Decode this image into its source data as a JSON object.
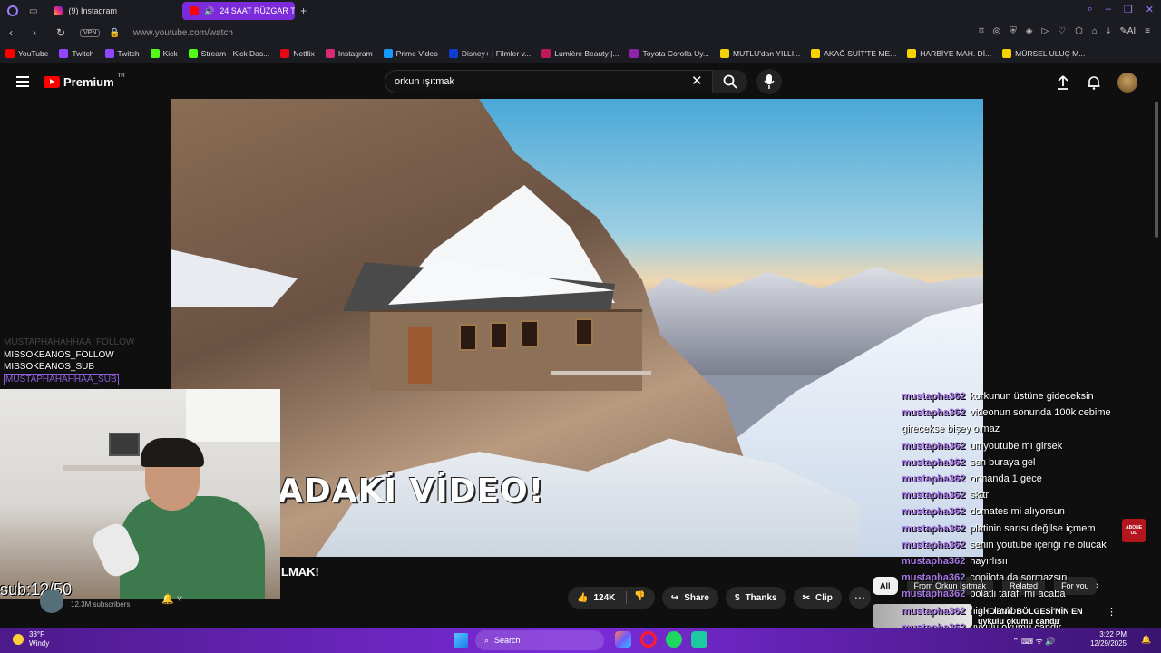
{
  "browser": {
    "tabs": [
      {
        "label": "(9) Instagram",
        "active": false,
        "icon": "instagram-icon"
      },
      {
        "label": "24 SAAT RÜZGAR TÜR",
        "active": true,
        "icon": "youtube-icon"
      }
    ],
    "new_tab": "+",
    "url": "www.youtube.com/watch",
    "vpn_label": "VPN",
    "ai_label": "AI",
    "bookmarks": [
      {
        "label": "YouTube",
        "color": "#ff0000"
      },
      {
        "label": "Twitch",
        "color": "#9146ff"
      },
      {
        "label": "Twitch",
        "color": "#9146ff"
      },
      {
        "label": "Kick",
        "color": "#53fc18"
      },
      {
        "label": "Stream - Kick Das...",
        "color": "#53fc18"
      },
      {
        "label": "Netflix",
        "color": "#e50914"
      },
      {
        "label": "Instagram",
        "color": "#d62976"
      },
      {
        "label": "Prime Video",
        "color": "#1399ff"
      },
      {
        "label": "Disney+ | Filmler v...",
        "color": "#113ccf"
      },
      {
        "label": "Lumière Beauty |...",
        "color": "#c2185b"
      },
      {
        "label": "Toyota Corolla Uy...",
        "color": "#8e24aa"
      },
      {
        "label": "MUTLU'dan YILLI...",
        "color": "#f5d300"
      },
      {
        "label": "AKAĞ SUİT'TE ME...",
        "color": "#f5d300"
      },
      {
        "label": "HARBİYE MAH. Dİ...",
        "color": "#f5d300"
      },
      {
        "label": "MÜRSEL ULUÇ M...",
        "color": "#f5d300"
      }
    ]
  },
  "youtube": {
    "logo_text": "Premium",
    "region": "TR",
    "search_value": "orkun ışıtmak",
    "video_overlay_text": "ADAKİ VİDEO!",
    "title_fragment": "LMAK!",
    "subscribers": "12.3M subscribers",
    "likes": "124K",
    "share_label": "Share",
    "thanks_label": "Thanks",
    "clip_label": "Clip",
    "chips": [
      "All",
      "From Orkun Işıtmak",
      "Related",
      "For you"
    ],
    "related_title": "AKDENİZ BÖLGESİ'NİN EN uykulu okumu candır"
  },
  "stream_overlay": {
    "events": [
      "MUSTAPHAHAHHAA_FOLLOW",
      "MISSOKEANOS_FOLLOW",
      "MISSOKEANOS_SUB",
      "MUSTAPHAHAHHAA_SUB"
    ],
    "sub_counter": "sub:12/50",
    "abone_badge": "ABONE OL",
    "chat": [
      {
        "user": "mustapha362",
        "text": "korkunun üstüne gideceksin"
      },
      {
        "user": "mustapha362",
        "text": "videonun sonunda 100k cebime girecekse bişey olmaz"
      },
      {
        "user": "mustapha362",
        "text": "uff youtube mı girsek"
      },
      {
        "user": "mustapha362",
        "text": "sen buraya gel"
      },
      {
        "user": "mustapha362",
        "text": "ormanda 1 gece"
      },
      {
        "user": "mustapha362",
        "text": "skttr"
      },
      {
        "user": "mustapha362",
        "text": "domates mi alıyorsun"
      },
      {
        "user": "mustapha362",
        "text": "platinin sarısı değilse içmem"
      },
      {
        "user": "mustapha362",
        "text": "senin youtube içeriği ne olucak"
      },
      {
        "user": "mustapha362",
        "text": "hayırlısıı"
      },
      {
        "user": "mustapha362",
        "text": "copilota da sormazsın"
      },
      {
        "user": "mustapha362",
        "text": "polatli tarafı mı acaba"
      },
      {
        "user": "mustapha362",
        "text": "night lamb"
      },
      {
        "user": "mustapha362",
        "text": "uykulu okumu candir"
      },
      {
        "user": "mustapha362",
        "text": "-35e kadar sıcak tutar"
      }
    ]
  },
  "taskbar": {
    "temp": "33°F",
    "weather": "Windy",
    "search_placeholder": "Search",
    "time": "3:22 PM",
    "date": "12/29/2025"
  }
}
